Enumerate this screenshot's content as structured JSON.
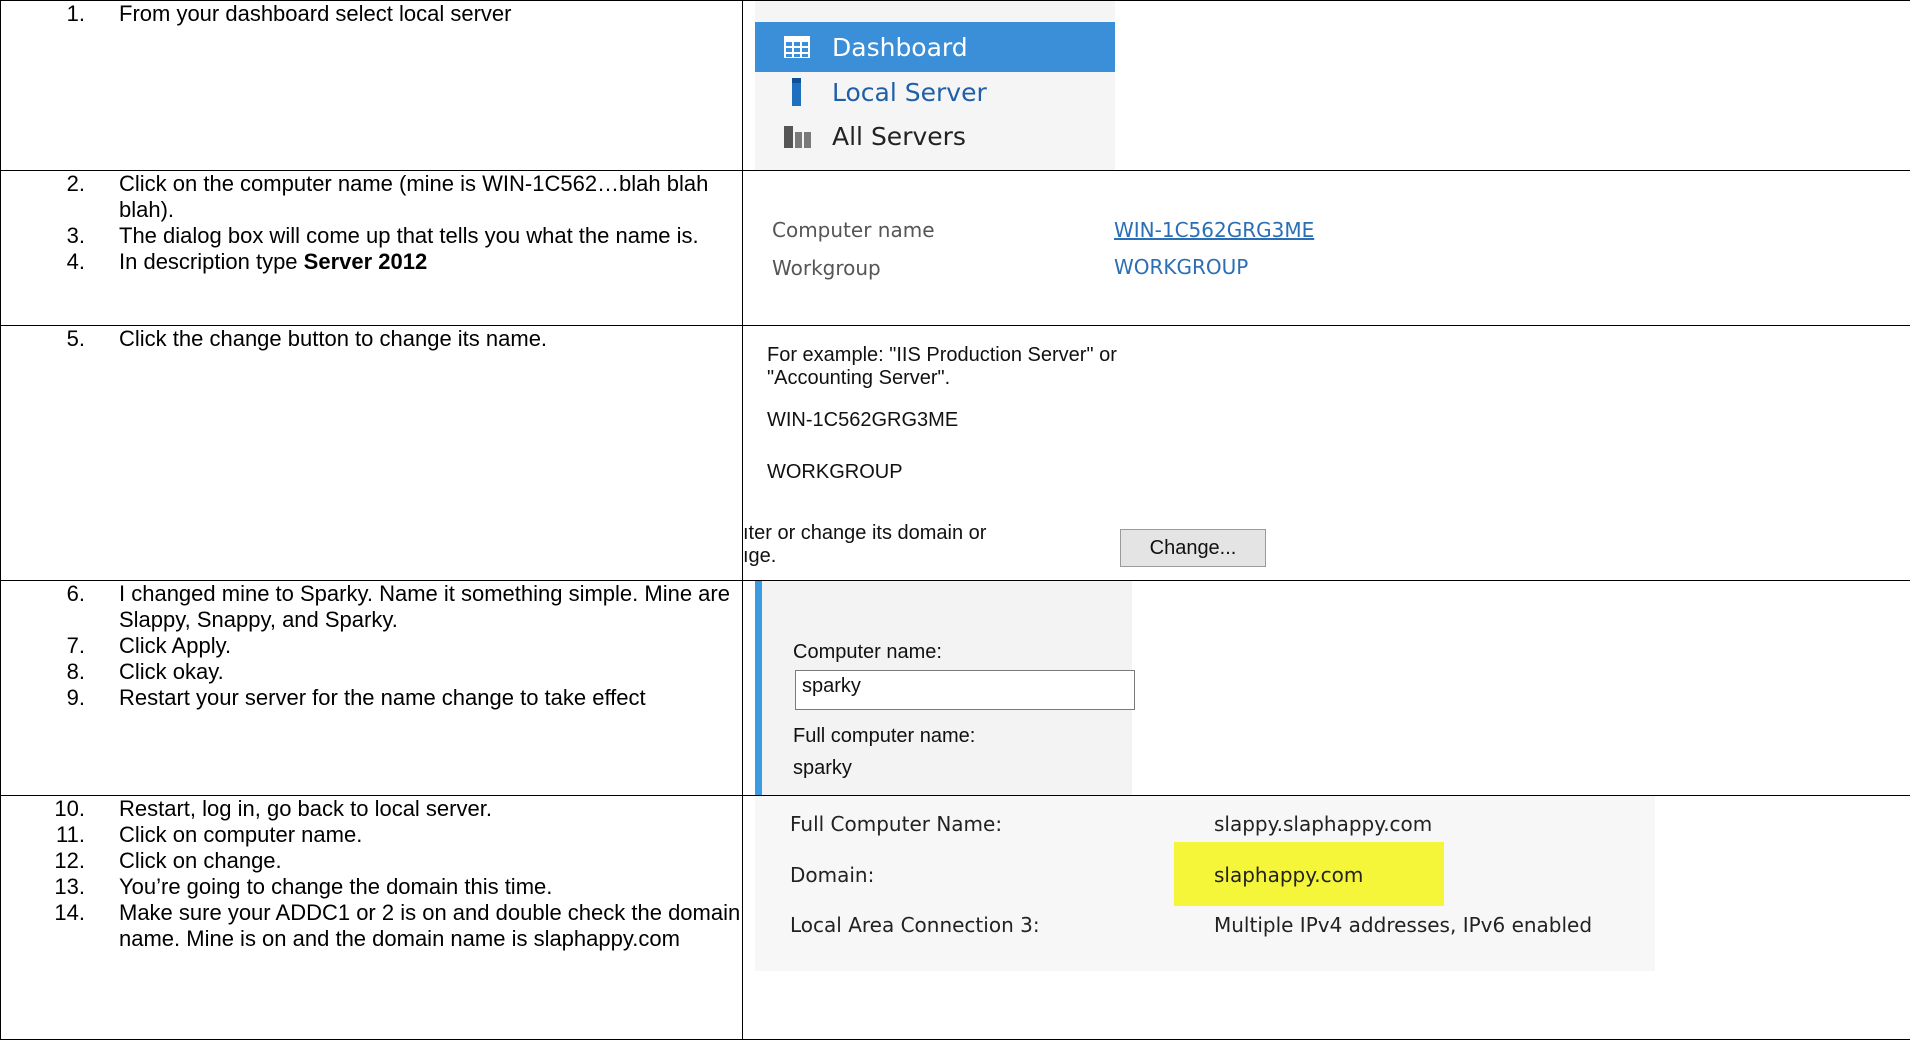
{
  "rows": [
    {
      "steps": [
        {
          "num": "1.",
          "text": "From your dashboard select local server"
        }
      ],
      "screenshot": {
        "nav_items": [
          {
            "label": "Dashboard",
            "icon": "dashboard-grid-icon",
            "active": true
          },
          {
            "label": "Local Server",
            "icon": "server-icon",
            "active": false
          },
          {
            "label": "All Servers",
            "icon": "servers-icon",
            "active": false
          }
        ]
      }
    },
    {
      "steps": [
        {
          "num": "2.",
          "text": "Click on the computer name (mine is WIN-1C562…blah blah blah)."
        },
        {
          "num": "3.",
          "text": "The dialog box will come up that tells you what the name is."
        },
        {
          "num": "4.",
          "text_before": "In description type ",
          "bold": "Server 2012"
        }
      ],
      "screenshot": {
        "props": [
          {
            "label": "Computer name",
            "value": "WIN-1C562GRG3ME"
          },
          {
            "label": "Workgroup",
            "value": "WORKGROUP"
          }
        ]
      }
    },
    {
      "steps": [
        {
          "num": "5.",
          "text": "Click the change button to change its name."
        }
      ],
      "screenshot": {
        "example_line1": "For example: \"IIS Production Server\" or",
        "example_line2": "\"Accounting Server\".",
        "computer_name": "WIN-1C562GRG3ME",
        "workgroup": "WORKGROUP",
        "rename_line1": "ıter or change its domain or",
        "rename_line2": "ıge.",
        "change_button": "Change..."
      }
    },
    {
      "steps": [
        {
          "num": "6.",
          "text": "I changed mine to Sparky. Name it something simple. Mine are Slappy, Snappy, and Sparky."
        },
        {
          "num": "7.",
          "text": "Click Apply."
        },
        {
          "num": "8.",
          "text": "Click okay."
        },
        {
          "num": "9.",
          "text": "Restart your server for the name change to take effect"
        }
      ],
      "screenshot": {
        "computer_name_label": "Computer name:",
        "computer_name_value": "sparky",
        "full_name_label": "Full computer name:",
        "full_name_value": "sparky"
      }
    },
    {
      "steps": [
        {
          "num": "10.",
          "text": "Restart, log in, go back to local server."
        },
        {
          "num": "11.",
          "text": "Click on computer name."
        },
        {
          "num": "12.",
          "text": "Click on change."
        },
        {
          "num": "13.",
          "text": "You’re going to change the domain this time."
        },
        {
          "num": "14.",
          "text": "Make sure your ADDC1 or 2 is on and double check the domain name. Mine is on and the domain name is slaphappy.com"
        }
      ],
      "screenshot": {
        "full_name_label": "Full Computer Name:",
        "full_name_value": "slappy.slaphappy.com",
        "domain_label": "Domain:",
        "domain_value": "slaphappy.com",
        "lan_label": "Local Area Connection 3:",
        "lan_value": "Multiple IPv4 addresses, IPv6 enabled",
        "highlight_color": "#f5f53a"
      }
    }
  ],
  "colors": {
    "nav_active_bg": "#3b8ed8",
    "link_blue": "#2a6fb6",
    "dialog_accent": "#3b9be2"
  }
}
